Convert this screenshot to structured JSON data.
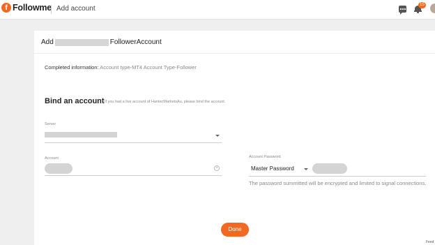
{
  "header": {
    "logo_mark": "f",
    "logo_text": "Followme",
    "breadcrumb": "Add account",
    "notification_count": "15"
  },
  "card": {
    "title_prefix": "Add",
    "title_suffix": "FollowerAccount"
  },
  "info": {
    "label": "Completed information:",
    "value": "Account type-MT4 Account Type-Follower"
  },
  "bind": {
    "title": "Bind an account",
    "hint": "If you had a live account of HantecMarketsAu, please bind the account."
  },
  "form": {
    "server_label": "Server",
    "account_label": "Account",
    "password_label": "Account Password",
    "password_type": "Master Password",
    "password_hint": "The password summitted will be encrypted and limited to signal connections."
  },
  "actions": {
    "done": "Done"
  },
  "footer": {
    "corner_text": "Feed"
  }
}
